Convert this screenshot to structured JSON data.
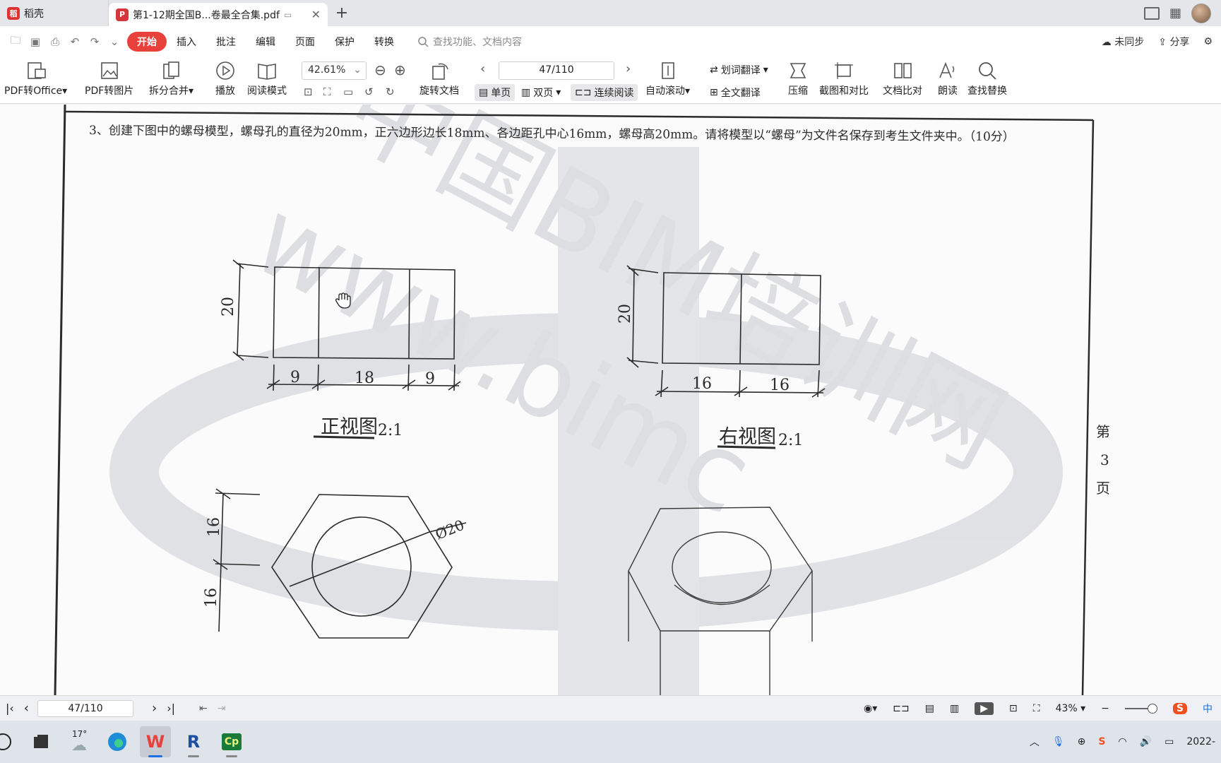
{
  "tabs": {
    "home_label": "稻壳",
    "doc_label": "第1-12期全国B...卷最全合集.pdf"
  },
  "menu": {
    "items": [
      "开始",
      "插入",
      "批注",
      "编辑",
      "页面",
      "保护",
      "转换"
    ],
    "search_placeholder": "查找功能、文档内容",
    "sync_label": "未同步",
    "share_label": "分享"
  },
  "toolbar": {
    "pdf_to_office": "PDF转Office",
    "pdf_to_image": "PDF转图片",
    "split_merge": "拆分合并",
    "play": "播放",
    "read_mode": "阅读模式",
    "zoom_value": "42.61%",
    "rotate_doc": "旋转文档",
    "page_value": "47/110",
    "single_page": "单页",
    "double_page": "双页",
    "continuous_read": "连续阅读",
    "auto_scroll": "自动滚动",
    "word_translate": "划词翻译",
    "full_translate": "全文翻译",
    "compress": "压缩",
    "screenshot_compare": "截图和对比",
    "doc_compare": "文档比对",
    "read_aloud": "朗读",
    "find_replace": "查找替换"
  },
  "document": {
    "question": "3、创建下图中的螺母模型，螺母孔的直径为20mm，正六边形边长18mm、各边距孔中心16mm，螺母高20mm。请将模型以“螺母”为文件名保存到考生文件夹中。（10分）",
    "front_view": {
      "height_label": "20",
      "dims": [
        "9",
        "18",
        "9"
      ],
      "caption": "正视图",
      "scale": "2:1"
    },
    "right_view": {
      "height_label": "20",
      "dims": [
        "16",
        "16"
      ],
      "caption": "右视图",
      "scale": "2:1"
    },
    "top_view": {
      "dims": [
        "16",
        "16"
      ],
      "diameter": "Ø20"
    },
    "side_page_label": [
      "第",
      "3",
      "页"
    ],
    "watermark_cn": "中国BIM培训网",
    "watermark_url": "www.bimc"
  },
  "statusbar": {
    "page_value": "47/110",
    "zoom_value": "43%"
  },
  "taskbar": {
    "temperature": "17°",
    "ime_label": "中",
    "date_partial": "2022-"
  },
  "colors": {
    "accent": "#e8413c",
    "page_line": "#2b2b2b",
    "watermark": "#9aa0a8"
  }
}
